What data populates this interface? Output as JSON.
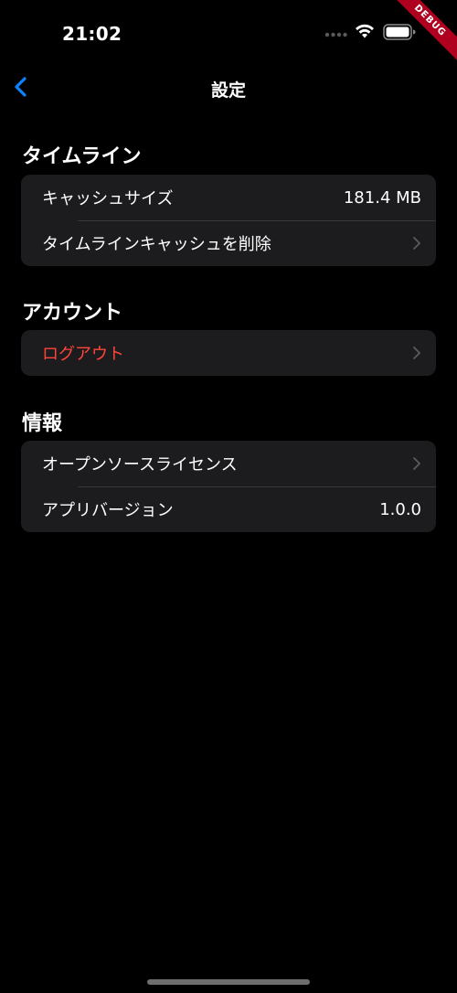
{
  "status_bar": {
    "time": "21:02",
    "icons": [
      "cellular-signal-icon",
      "wifi-icon",
      "battery-icon"
    ]
  },
  "debug_banner": "DEBUG",
  "nav": {
    "title": "設定",
    "back_icon": "chevron-left-icon"
  },
  "sections": [
    {
      "header": "タイムライン",
      "rows": [
        {
          "label": "キャッシュサイズ",
          "value": "181.4 MB"
        },
        {
          "label": "タイムラインキャッシュを削除",
          "accessory": "chevron-right-icon"
        }
      ]
    },
    {
      "header": "アカウント",
      "rows": [
        {
          "label": "ログアウト",
          "accessory": "chevron-right-icon",
          "style": "destructive"
        }
      ]
    },
    {
      "header": "情報",
      "rows": [
        {
          "label": "オープンソースライセンス",
          "accessory": "chevron-right-icon"
        },
        {
          "label": "アプリバージョン",
          "value": "1.0.0"
        }
      ]
    }
  ],
  "colors": {
    "background": "#000000",
    "group_background": "#1c1c1e",
    "separator": "#38383a",
    "accent": "#0a84ff",
    "destructive": "#ff453a",
    "chevron": "#5a5a5f",
    "debug_ribbon": "#b00020"
  }
}
